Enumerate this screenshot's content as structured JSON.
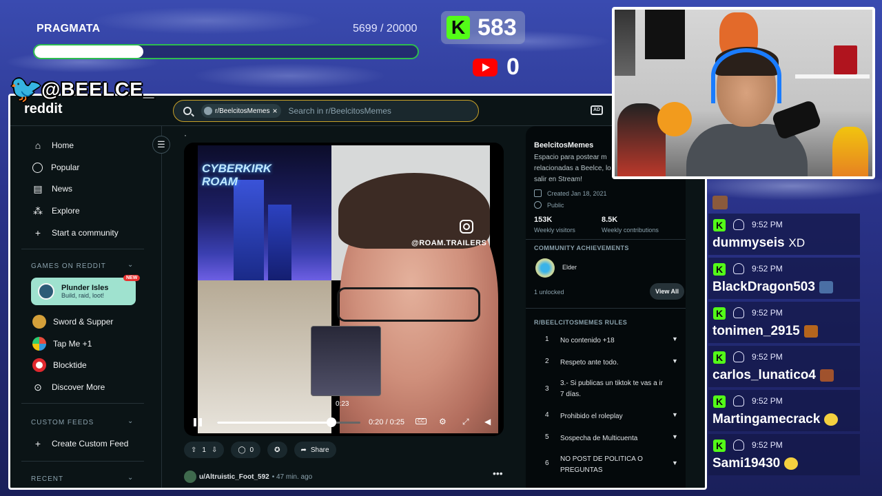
{
  "overlay": {
    "goal_title": "PRAGMATA",
    "goal_count": "5699 / 20000",
    "goal_fraction": 0.285,
    "kick_count": "583",
    "youtube_count": "0",
    "twitter_handle": "@BEELCE_",
    "colors": {
      "kick_green": "#53fc18",
      "youtube_red": "#ff0000",
      "background": "#2a338a"
    }
  },
  "reddit": {
    "logo": "reddit",
    "search": {
      "chip": "r/BeelcitosMemes",
      "placeholder": "Search in r/BeelcitosMemes"
    },
    "nav": [
      {
        "label": "Home",
        "icon": "home-icon"
      },
      {
        "label": "Popular",
        "icon": "popular-icon"
      },
      {
        "label": "News",
        "icon": "news-icon"
      },
      {
        "label": "Explore",
        "icon": "explore-icon"
      },
      {
        "label": "Start a community",
        "icon": "plus-icon"
      }
    ],
    "games_title": "GAMES ON REDDIT",
    "featured_game": {
      "title": "Plunder Isles",
      "subtitle": "Build, raid, loot!",
      "badge": "NEW"
    },
    "games": [
      {
        "label": "Sword & Supper"
      },
      {
        "label": "Tap Me +1"
      },
      {
        "label": "Blocktide"
      },
      {
        "label": "Discover More"
      }
    ],
    "custom_feeds_title": "CUSTOM FEEDS",
    "create_custom_feed": "Create Custom Feed",
    "recent_title": "RECENT",
    "post": {
      "dot": "·",
      "video": {
        "overlay_text": "CYBERKIRK\nROAM",
        "watermark": "@ROAM.TRAILERS",
        "preview_time": "0:23",
        "time": "0:20 / 0:25",
        "progress_fraction": 0.8,
        "cc": "CC"
      },
      "votes": "1",
      "comments": "0",
      "share": "Share",
      "author": "u/Altruistic_Foot_592",
      "author_time": "• 47 min. ago",
      "more": "•••"
    },
    "community": {
      "name": "BeelcitosMemes",
      "description": "Espacio para postear m relacionadas a Beelce, lo salir en Stream!",
      "created": "Created Jan 18, 2021",
      "visibility": "Public",
      "visitors_value": "153K",
      "visitors_label": "Weekly visitors",
      "contrib_value": "8.5K",
      "contrib_label": "Weekly contributions",
      "achievements_title": "COMMUNITY ACHIEVEMENTS",
      "achievement": "Elder",
      "unlocked": "1 unlocked",
      "view_all": "View All",
      "rules_title": "R/BEELCITOSMEMES RULES",
      "rules": [
        {
          "num": "1",
          "text": "No contenido +18"
        },
        {
          "num": "2",
          "text": "Respeto ante todo."
        },
        {
          "num": "3",
          "text": "3.- Si publicas un tiktok te vas a ir 7 días."
        },
        {
          "num": "4",
          "text": "Prohibido el roleplay"
        },
        {
          "num": "5",
          "text": "Sospecha de Multicuenta"
        },
        {
          "num": "6",
          "text": "NO POST DE POLITICA O PREGUNTAS"
        }
      ]
    }
  },
  "chat": {
    "messages": [
      {
        "time": "9:52 PM",
        "user": "dummyseis",
        "text": "XD",
        "emote": ""
      },
      {
        "time": "9:52 PM",
        "user": "BlackDragon503",
        "text": "",
        "emote": "#4a6fa5"
      },
      {
        "time": "9:52 PM",
        "user": "tonimen_2915",
        "text": "",
        "emote": "#b5651d"
      },
      {
        "time": "9:52 PM",
        "user": "carlos_lunatico4",
        "text": "",
        "emote": "#a0522d"
      },
      {
        "time": "9:52 PM",
        "user": "Martingamecrack",
        "text": "",
        "emote": "#f4d03f"
      },
      {
        "time": "9:52 PM",
        "user": "Sami19430",
        "text": "",
        "emote": "#f4d03f"
      }
    ]
  }
}
